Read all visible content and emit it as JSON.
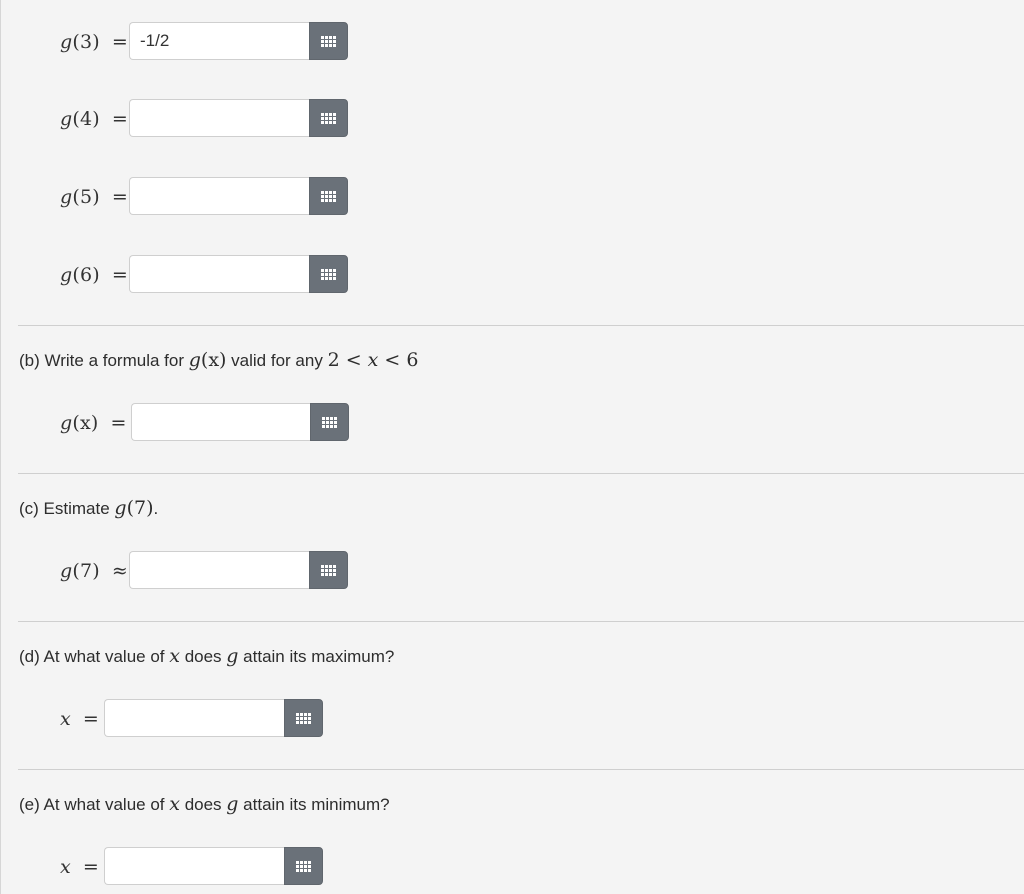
{
  "part_a_rows": [
    {
      "fn": "g",
      "arg": "(3)",
      "op": "=",
      "value": "-1/2"
    },
    {
      "fn": "g",
      "arg": "(4)",
      "op": "=",
      "value": ""
    },
    {
      "fn": "g",
      "arg": "(5)",
      "op": "=",
      "value": ""
    },
    {
      "fn": "g",
      "arg": "(6)",
      "op": "=",
      "value": ""
    }
  ],
  "part_b": {
    "prefix": "(b) Write a formula for ",
    "fn": "g",
    "arg": "(x)",
    "mid": " valid for any ",
    "cond_a": "2 < ",
    "cond_var": "x",
    "cond_b": " < 6",
    "answer_fn": "g",
    "answer_arg": "(x)",
    "answer_op": "=",
    "answer_value": ""
  },
  "part_c": {
    "prefix": "(c) Estimate ",
    "fn": "g",
    "arg": "(7)",
    "suffix": ".",
    "answer_fn": "g",
    "answer_arg": "(7)",
    "answer_op": "≈",
    "answer_value": ""
  },
  "part_d": {
    "prefix": "(d) At what value of ",
    "var": "x",
    "mid": " does ",
    "fn": "g",
    "suffix": " attain its maximum?",
    "answer_var": "x",
    "answer_op": "=",
    "answer_value": ""
  },
  "part_e": {
    "prefix": "(e) At what value of ",
    "var": "x",
    "mid": " does ",
    "fn": "g",
    "suffix": " attain its minimum?",
    "answer_var": "x",
    "answer_op": "=",
    "answer_value": ""
  },
  "icons": {
    "keyboard_button": "math-palette-grid-icon"
  },
  "colors": {
    "background": "#f4f4f4",
    "button": "#6a7179",
    "divider": "#cfcfcf"
  }
}
